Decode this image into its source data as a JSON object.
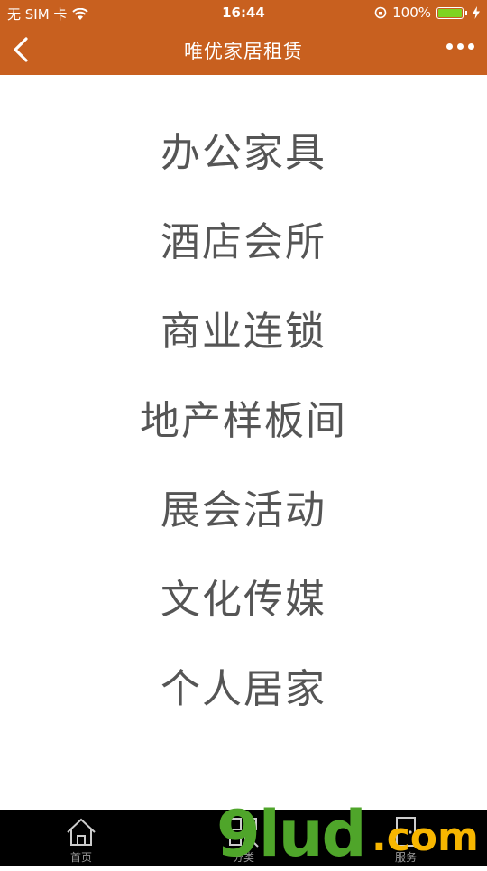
{
  "status_bar": {
    "carrier": "无 SIM 卡",
    "time": "16:44",
    "battery_percent": "100%",
    "battery_level": 1.0,
    "colors": {
      "battery": "#7ed321"
    }
  },
  "nav": {
    "title": "唯优家居租赁",
    "back_icon": "chevron-left-icon",
    "more_icon": "more-dots-icon"
  },
  "menu": {
    "items": [
      {
        "label": "办公家具"
      },
      {
        "label": "酒店会所"
      },
      {
        "label": "商业连锁"
      },
      {
        "label": "地产样板间"
      },
      {
        "label": "展会活动"
      },
      {
        "label": "文化传媒"
      },
      {
        "label": "个人居家"
      }
    ]
  },
  "tab_bar": {
    "tabs": [
      {
        "label": "首页",
        "icon": "home-icon"
      },
      {
        "label": "分类",
        "icon": "grid-search-icon"
      },
      {
        "label": "服务",
        "icon": "door-icon"
      }
    ]
  },
  "watermark": {
    "text": "9lud",
    "suffix": ".com"
  },
  "colors": {
    "brand": "#c8601f",
    "menu_text": "#555555",
    "tab_bar_bg": "#000000"
  }
}
